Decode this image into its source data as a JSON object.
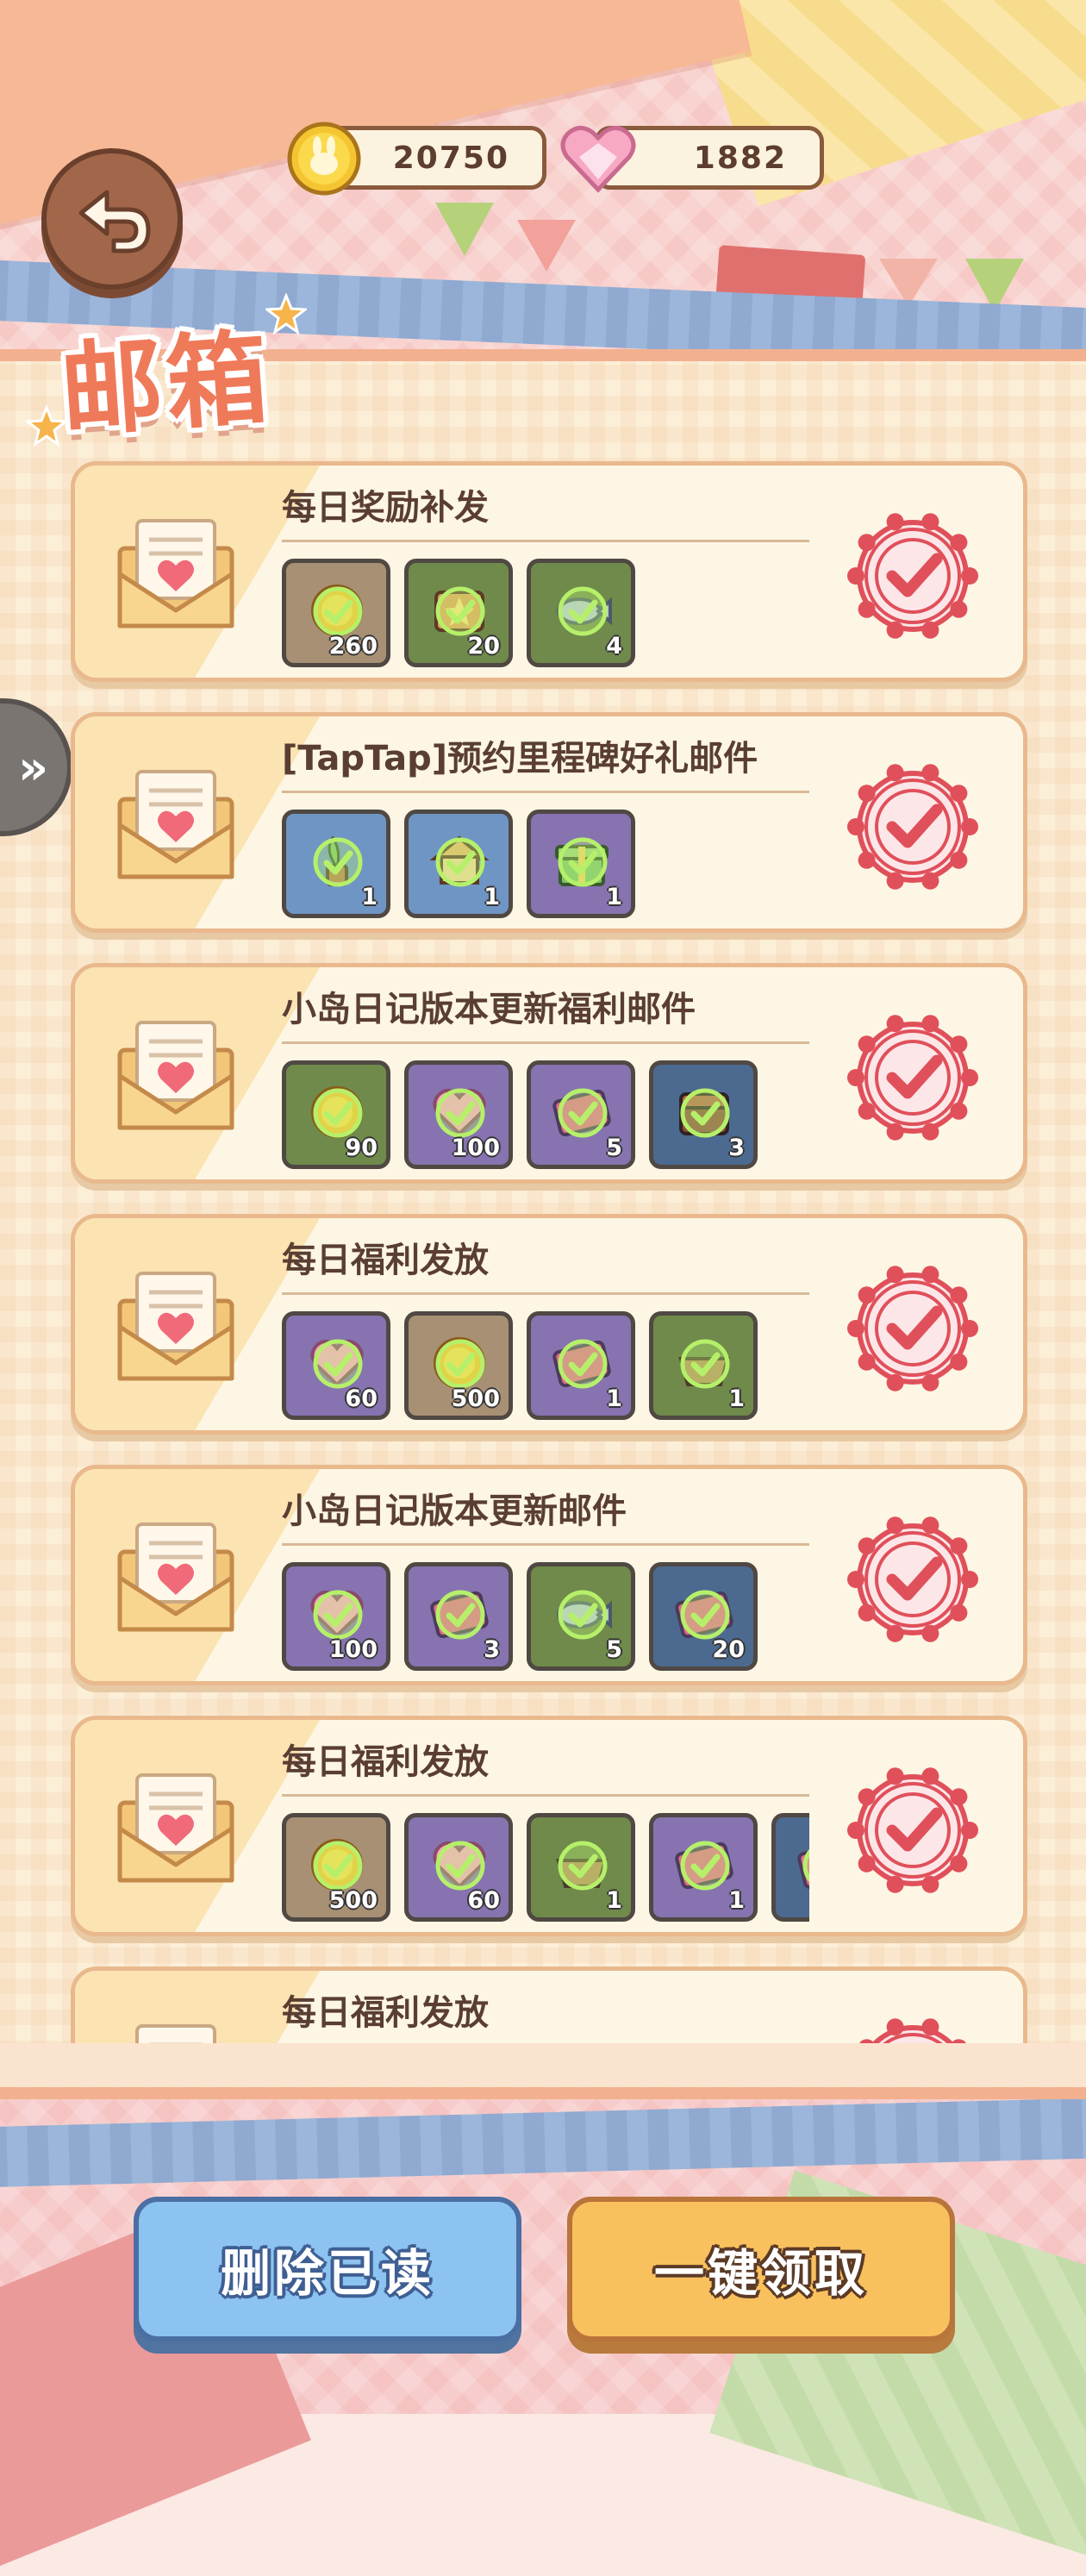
{
  "header": {
    "coins": "20750",
    "hearts": "1882"
  },
  "title": "邮箱",
  "mails": [
    {
      "title": "每日奖励补发",
      "items": [
        {
          "type": "coin",
          "bg": "#a89074",
          "qty": "260"
        },
        {
          "type": "star-ticket",
          "bg": "#6f8a4a",
          "qty": "20"
        },
        {
          "type": "fish",
          "bg": "#6f8a4a",
          "qty": "4"
        }
      ]
    },
    {
      "title": "[TapTap]预约里程碑好礼邮件",
      "items": [
        {
          "type": "plant",
          "bg": "#6f95c4",
          "qty": "1"
        },
        {
          "type": "house",
          "bg": "#6f95c4",
          "qty": "1"
        },
        {
          "type": "gift",
          "bg": "#8673b0",
          "qty": "1"
        }
      ]
    },
    {
      "title": "小岛日记版本更新福利邮件",
      "items": [
        {
          "type": "coin",
          "bg": "#6f8a4a",
          "qty": "90"
        },
        {
          "type": "heart",
          "bg": "#8673b0",
          "qty": "100"
        },
        {
          "type": "ticket",
          "bg": "#8673b0",
          "qty": "5"
        },
        {
          "type": "chest",
          "bg": "#4c6a8f",
          "qty": "3"
        }
      ]
    },
    {
      "title": "每日福利发放",
      "items": [
        {
          "type": "heart",
          "bg": "#8673b0",
          "qty": "60"
        },
        {
          "type": "coin",
          "bg": "#a89074",
          "qty": "500"
        },
        {
          "type": "ticket",
          "bg": "#8673b0",
          "qty": "1"
        },
        {
          "type": "basket",
          "bg": "#6f8a4a",
          "qty": "1"
        }
      ]
    },
    {
      "title": "小岛日记版本更新邮件",
      "items": [
        {
          "type": "heart",
          "bg": "#8673b0",
          "qty": "100"
        },
        {
          "type": "ticket",
          "bg": "#8673b0",
          "qty": "3"
        },
        {
          "type": "fish",
          "bg": "#6f8a4a",
          "qty": "5"
        },
        {
          "type": "ticket",
          "bg": "#4c6a8f",
          "qty": "20"
        }
      ]
    },
    {
      "title": "每日福利发放",
      "items": [
        {
          "type": "coin",
          "bg": "#a89074",
          "qty": "500"
        },
        {
          "type": "heart",
          "bg": "#8673b0",
          "qty": "60"
        },
        {
          "type": "basket",
          "bg": "#6f8a4a",
          "qty": "1"
        },
        {
          "type": "ticket",
          "bg": "#8673b0",
          "qty": "1"
        },
        {
          "type": "ticket",
          "bg": "#4c6a8f",
          "qty": ""
        }
      ]
    },
    {
      "title": "每日福利发放",
      "items": []
    }
  ],
  "buttons": {
    "delete_read": "删除已读",
    "claim_all": "一键领取"
  },
  "colors": {
    "check_green": "#b6f06a",
    "stamp_red": "#e0505a",
    "accent_orange": "#ef7a5a"
  },
  "icons": {
    "back": "back-arrow-icon",
    "coin": "bunny-coin-icon",
    "heart": "heart-gem-icon",
    "envelope": "envelope-icon",
    "claimed": "claimed-stamp-icon",
    "side_tab": "double-chevron-right-icon"
  }
}
